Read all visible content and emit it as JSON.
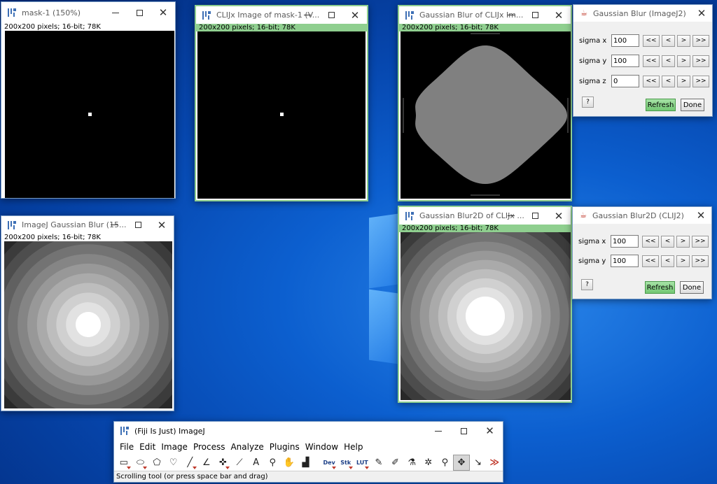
{
  "desktop": {
    "background": "#0a5ccc"
  },
  "windows": {
    "mask": {
      "title": "mask-1 (150%)",
      "info": "200x200 pixels; 16-bit; 78K"
    },
    "clij_image": {
      "title": "CLIJx Image of mask-1 (V...",
      "info": "200x200 pixels; 16-bit; 78K",
      "border_color": "#8fcf8f"
    },
    "gauss_clij": {
      "title": "Gaussian Blur of CLIJx Im...",
      "info": "200x200 pixels; 16-bit; 78K"
    },
    "imagej_gauss": {
      "title": "ImageJ Gaussian Blur (15...",
      "info": "200x200 pixels; 16-bit; 78K"
    },
    "gauss2d": {
      "title": "Gaussian Blur2D of CLIJx ...",
      "info": "200x200 pixels; 16-bit; 78K"
    }
  },
  "dialog_imagej": {
    "title": "Gaussian Blur (ImageJ2)",
    "rows": [
      {
        "label": "sigma x",
        "value": "100"
      },
      {
        "label": "sigma y",
        "value": "100"
      },
      {
        "label": "sigma z",
        "value": "0"
      }
    ],
    "step_buttons": [
      "<<",
      "<",
      ">",
      ">>"
    ],
    "help": "?",
    "refresh": "Refresh",
    "done": "Done"
  },
  "dialog_clij2": {
    "title": "Gaussian Blur2D (CLIJ2)",
    "rows": [
      {
        "label": "sigma x",
        "value": "100"
      },
      {
        "label": "sigma y",
        "value": "100"
      }
    ],
    "step_buttons": [
      "<<",
      "<",
      ">",
      ">>"
    ],
    "help": "?",
    "refresh": "Refresh",
    "done": "Done"
  },
  "fiji": {
    "title": "(Fiji Is Just) ImageJ",
    "menus": [
      "File",
      "Edit",
      "Image",
      "Process",
      "Analyze",
      "Plugins",
      "Window",
      "Help"
    ],
    "tools": [
      {
        "name": "rectangle-tool-icon",
        "glyph": "▭",
        "tri": true
      },
      {
        "name": "oval-tool-icon",
        "glyph": "⬭",
        "tri": true
      },
      {
        "name": "polygon-tool-icon",
        "glyph": "⬠",
        "tri": false
      },
      {
        "name": "freehand-tool-icon",
        "glyph": "♡",
        "tri": false
      },
      {
        "name": "line-tool-icon",
        "glyph": "╱",
        "tri": true
      },
      {
        "name": "angle-tool-icon",
        "glyph": "∠",
        "tri": false
      },
      {
        "name": "point-tool-icon",
        "glyph": "✜",
        "tri": true
      },
      {
        "name": "wand-tool-icon",
        "glyph": "⟋",
        "tri": false
      },
      {
        "name": "text-tool-icon",
        "glyph": "A",
        "tri": false
      },
      {
        "name": "magnifier-tool-icon",
        "glyph": "⚲",
        "tri": false
      },
      {
        "name": "hand-tool-icon",
        "glyph": "✋",
        "tri": false
      },
      {
        "name": "color-picker-tool-icon",
        "glyph": "▟",
        "tri": false
      },
      {
        "name": "dev-tool-icon",
        "glyph": "Dev",
        "tri": true,
        "label": true,
        "sep": true
      },
      {
        "name": "stk-tool-icon",
        "glyph": "Stk",
        "tri": true,
        "label": true
      },
      {
        "name": "lut-tool-icon",
        "glyph": "LUT",
        "tri": true,
        "label": true
      },
      {
        "name": "pencil-tool-icon",
        "glyph": "✎",
        "tri": false
      },
      {
        "name": "brush-tool-icon",
        "glyph": "✐",
        "tri": false
      },
      {
        "name": "flood-fill-tool-icon",
        "glyph": "⚗",
        "tri": false
      },
      {
        "name": "spray-tool-icon",
        "glyph": "✲",
        "tri": false
      },
      {
        "name": "zoom-tool-icon",
        "glyph": "⚲",
        "tri": false
      },
      {
        "name": "scrolling-tool-icon",
        "glyph": "✥",
        "tri": false,
        "selected": true
      },
      {
        "name": "arrow-tool-icon",
        "glyph": "↘",
        "tri": false
      },
      {
        "name": "more-tools-icon",
        "glyph": "≫",
        "tri": false,
        "red": true
      }
    ],
    "status": "Scrolling tool (or press space bar and drag)"
  }
}
